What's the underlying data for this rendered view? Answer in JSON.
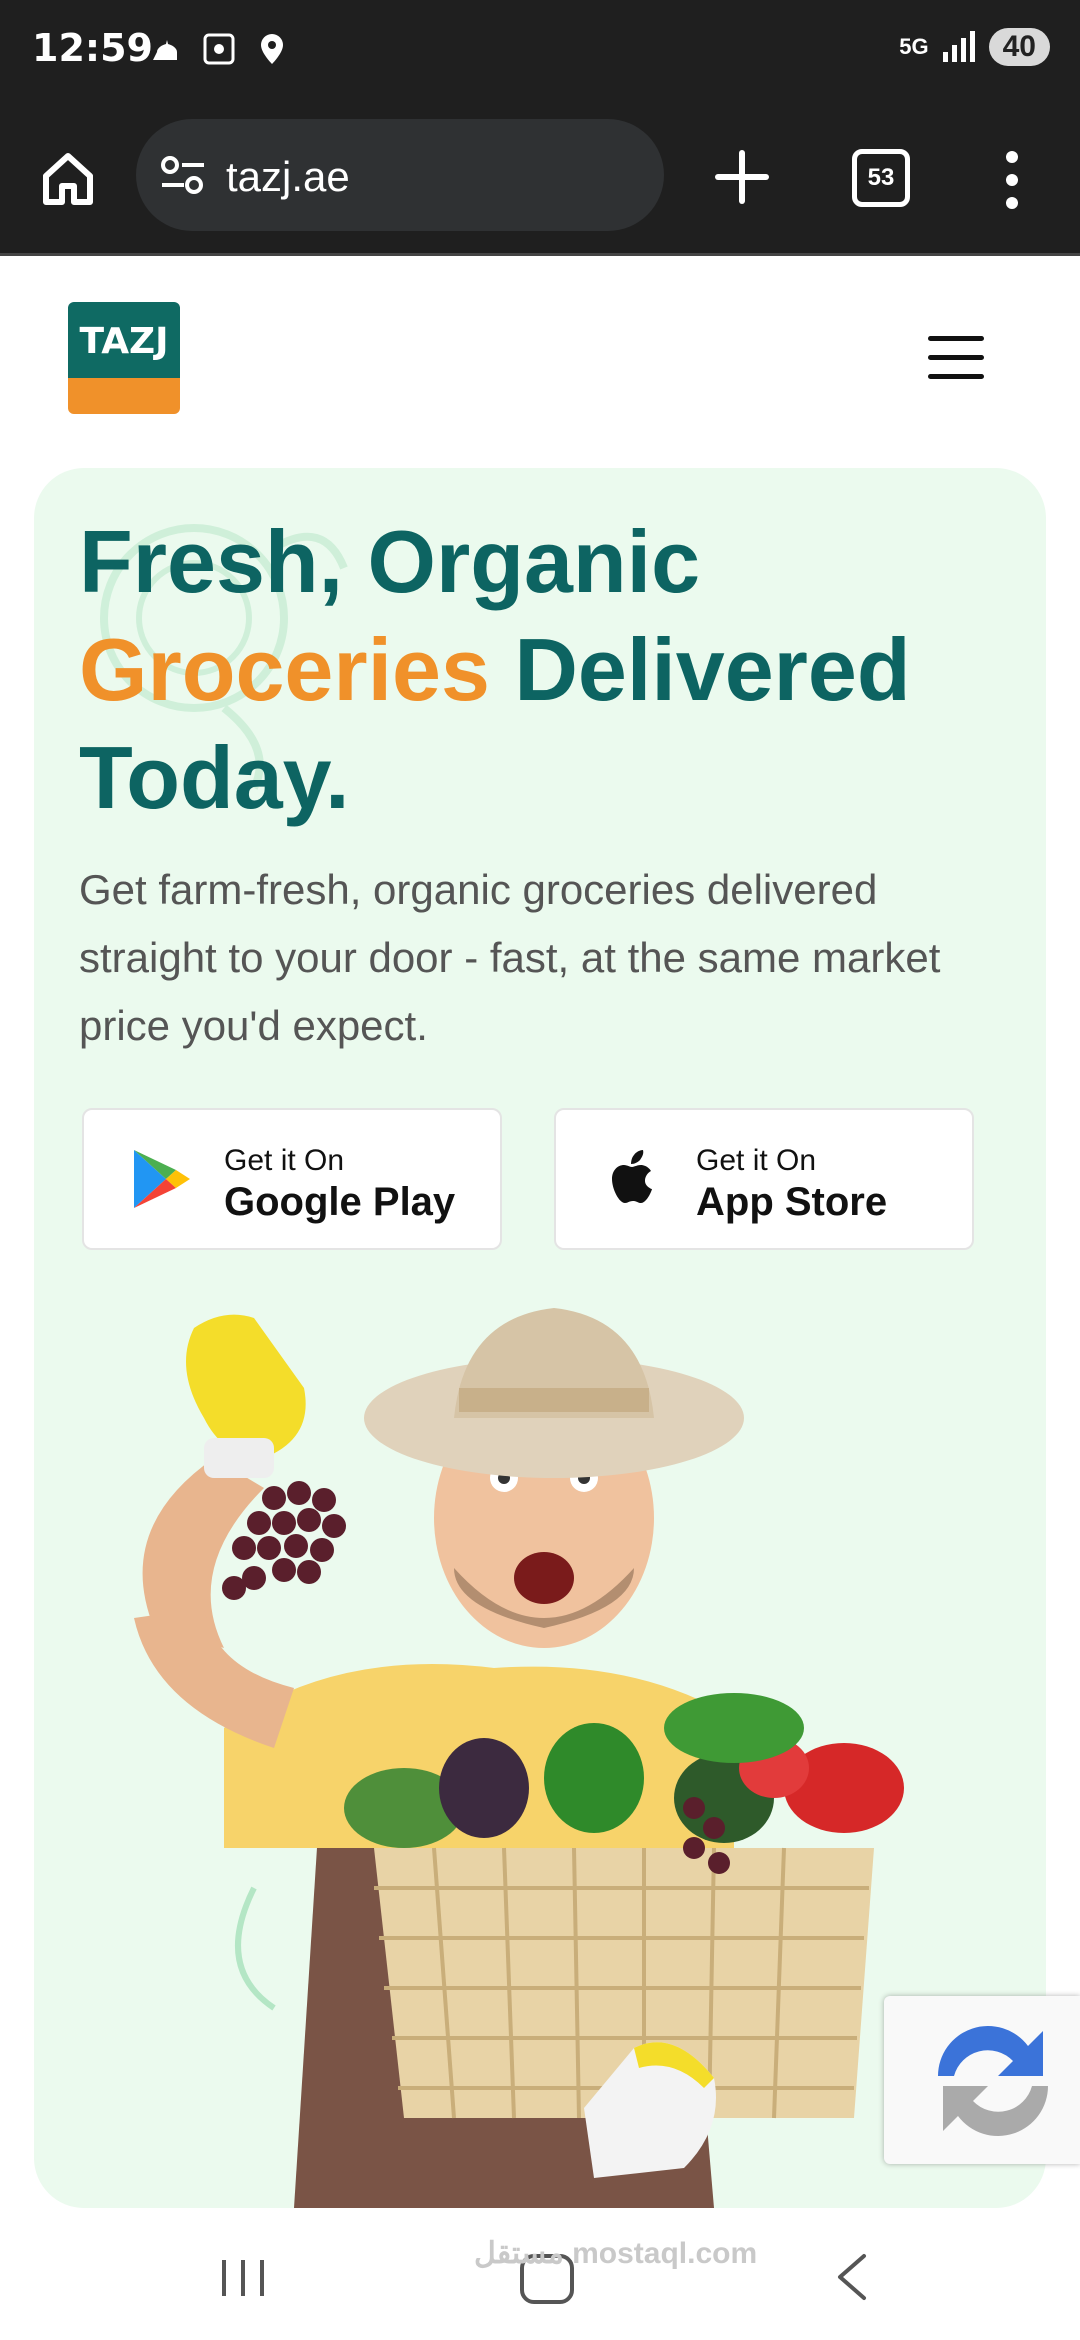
{
  "status_bar": {
    "time": "12:59",
    "network": "5G",
    "battery": "40"
  },
  "browser": {
    "url": "tazj.ae",
    "tab_count": "53"
  },
  "site": {
    "logo_text": "TAZJ"
  },
  "hero": {
    "headline_part1": "Fresh, Organic",
    "headline_accent": "Groceries",
    "headline_part2": "Delivered Today.",
    "subtitle": "Get farm-fresh, organic groceries delivered straight to your door - fast, at the same market price you'd expect.",
    "google_play": {
      "small": "Get it On",
      "big": "Google Play"
    },
    "app_store": {
      "small": "Get it On",
      "big": "App Store"
    }
  },
  "watermark": "مستقل mostaql.com",
  "colors": {
    "brand_teal": "#0d6462",
    "brand_orange": "#f0912a",
    "hero_bg": "#ebfaee"
  },
  "icons": [
    "home-icon",
    "tune-icon",
    "plus-icon",
    "tabs-icon",
    "more-vert-icon",
    "hamburger-icon",
    "google-play-icon",
    "apple-icon",
    "recaptcha-icon"
  ]
}
